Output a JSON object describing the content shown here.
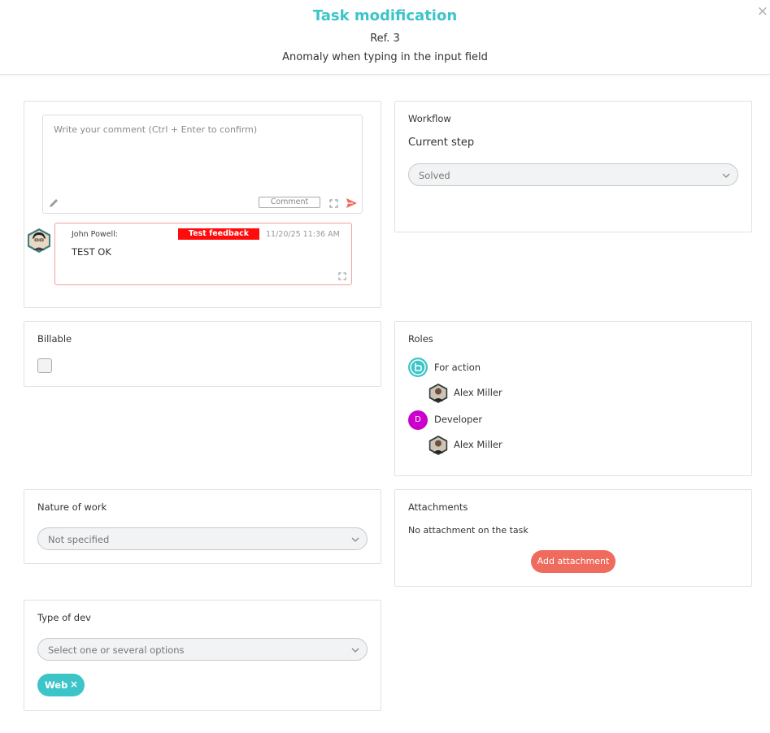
{
  "header": {
    "title": "Task modification",
    "ref": "Ref. 3",
    "subtitle": "Anomaly when typing in the input field",
    "close_symbol": "×"
  },
  "comment": {
    "placeholder": "Write your comment (Ctrl + Enter to confirm)",
    "button_label": "Comment",
    "entries": [
      {
        "author": "John Powell:",
        "tag": "Test feedback",
        "date": "11/20/25 11:36 AM",
        "text": "TEST OK"
      }
    ]
  },
  "workflow": {
    "label": "Workflow",
    "current_step_label": "Current step",
    "value": "Solved"
  },
  "billable": {
    "label": "Billable",
    "checked": false
  },
  "roles": {
    "label": "Roles",
    "items": [
      {
        "role": "For action",
        "icon": "for-action-icon",
        "color": "#3cc5c9",
        "assignee": "Alex Miller"
      },
      {
        "role": "Developer",
        "icon_letter": "D",
        "color": "#cc00cc",
        "assignee": "Alex Miller"
      }
    ]
  },
  "nature_of_work": {
    "label": "Nature of work",
    "value": "Not specified"
  },
  "attachments": {
    "label": "Attachments",
    "empty_text": "No attachment on the task",
    "add_button": "Add attachment"
  },
  "type_of_dev": {
    "label": "Type of dev",
    "placeholder": "Select one or several options",
    "selected": [
      {
        "label": "Web",
        "remove_symbol": "×"
      }
    ]
  },
  "colors": {
    "accent": "#3cc5c9",
    "danger": "#ff0b0b",
    "button": "#ef6b5d",
    "developer": "#cc00cc"
  }
}
